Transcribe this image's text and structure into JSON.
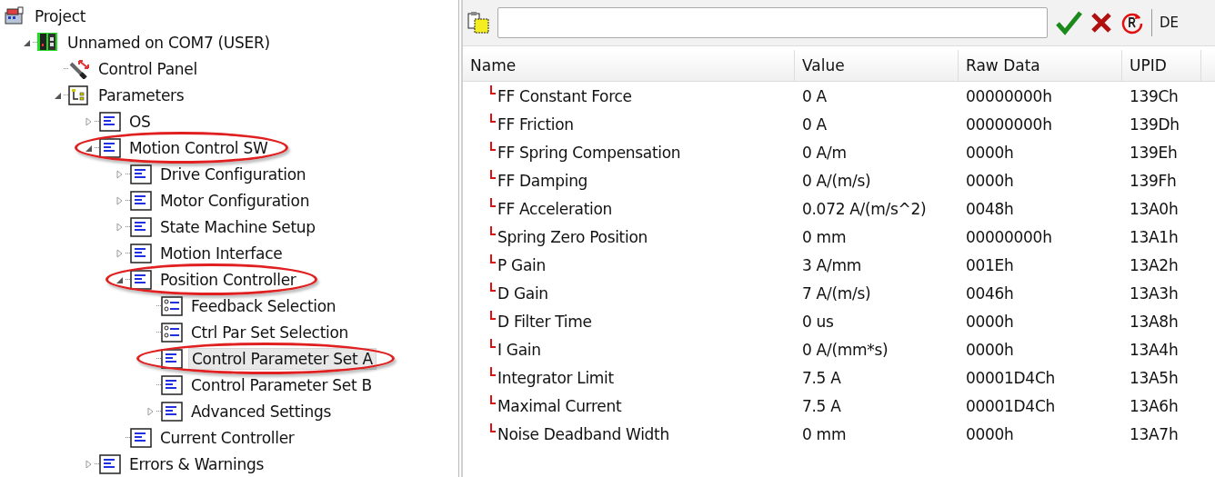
{
  "tree": [
    {
      "label": "Project",
      "kind": "project",
      "children": [
        {
          "label": "Unnamed on COM7 (USER)",
          "kind": "device",
          "expanded": true,
          "children": [
            {
              "label": "Control Panel",
              "kind": "panel"
            },
            {
              "label": "Parameters",
              "kind": "params",
              "expanded": true,
              "children": [
                {
                  "label": "OS",
                  "kind": "list",
                  "expanded": false
                },
                {
                  "label": "Motion Control SW",
                  "kind": "list",
                  "expanded": true,
                  "highlighted": true,
                  "children": [
                    {
                      "label": "Drive Configuration",
                      "kind": "list",
                      "expanded": false
                    },
                    {
                      "label": "Motor Configuration",
                      "kind": "list",
                      "expanded": false
                    },
                    {
                      "label": "State Machine Setup",
                      "kind": "list",
                      "expanded": false
                    },
                    {
                      "label": "Motion Interface",
                      "kind": "list",
                      "expanded": false
                    },
                    {
                      "label": "Position Controller",
                      "kind": "list",
                      "expanded": true,
                      "highlighted": true,
                      "children": [
                        {
                          "label": "Feedback Selection",
                          "kind": "selection"
                        },
                        {
                          "label": "Ctrl Par Set Selection",
                          "kind": "selection"
                        },
                        {
                          "label": "Control Parameter Set A",
                          "kind": "list",
                          "highlighted": true,
                          "selected": true
                        },
                        {
                          "label": "Control Parameter Set B",
                          "kind": "list",
                          "selected": false
                        },
                        {
                          "label": "Advanced Settings",
                          "kind": "list",
                          "expanded": false
                        }
                      ]
                    },
                    {
                      "label": "Current Controller",
                      "kind": "list"
                    }
                  ]
                },
                {
                  "label": "Errors & Warnings",
                  "kind": "list",
                  "expanded": false
                }
              ]
            }
          ]
        }
      ]
    }
  ],
  "toolbar": {
    "cut_label": "DE"
  },
  "table": {
    "columns": [
      "Name",
      "Value",
      "Raw Data",
      "UPID"
    ],
    "rows": [
      {
        "name": "FF Constant Force",
        "value": "0 A",
        "raw": "00000000h",
        "upid": "139Ch"
      },
      {
        "name": "FF Friction",
        "value": "0 A",
        "raw": "00000000h",
        "upid": "139Dh"
      },
      {
        "name": "FF Spring Compensation",
        "value": "0 A/m",
        "raw": "0000h",
        "upid": "139Eh"
      },
      {
        "name": "FF Damping",
        "value": "0 A/(m/s)",
        "raw": "0000h",
        "upid": "139Fh"
      },
      {
        "name": "FF Acceleration",
        "value": "0.072 A/(m/s^2)",
        "raw": "0048h",
        "upid": "13A0h"
      },
      {
        "name": "Spring Zero Position",
        "value": "0 mm",
        "raw": "00000000h",
        "upid": "13A1h"
      },
      {
        "name": "P Gain",
        "value": "3 A/mm",
        "raw": "001Eh",
        "upid": "13A2h"
      },
      {
        "name": "D Gain",
        "value": "7 A/(m/s)",
        "raw": "0046h",
        "upid": "13A3h"
      },
      {
        "name": "D Filter Time",
        "value": "0 us",
        "raw": "0000h",
        "upid": "13A8h"
      },
      {
        "name": "I Gain",
        "value": "0 A/(mm*s)",
        "raw": "0000h",
        "upid": "13A4h"
      },
      {
        "name": "Integrator Limit",
        "value": "7.5 A",
        "raw": "00001D4Ch",
        "upid": "13A5h"
      },
      {
        "name": "Maximal Current",
        "value": "7.5 A",
        "raw": "00001D4Ch",
        "upid": "13A6h"
      },
      {
        "name": "Noise Deadband Width",
        "value": "0 mm",
        "raw": "0000h",
        "upid": "13A7h"
      }
    ]
  }
}
